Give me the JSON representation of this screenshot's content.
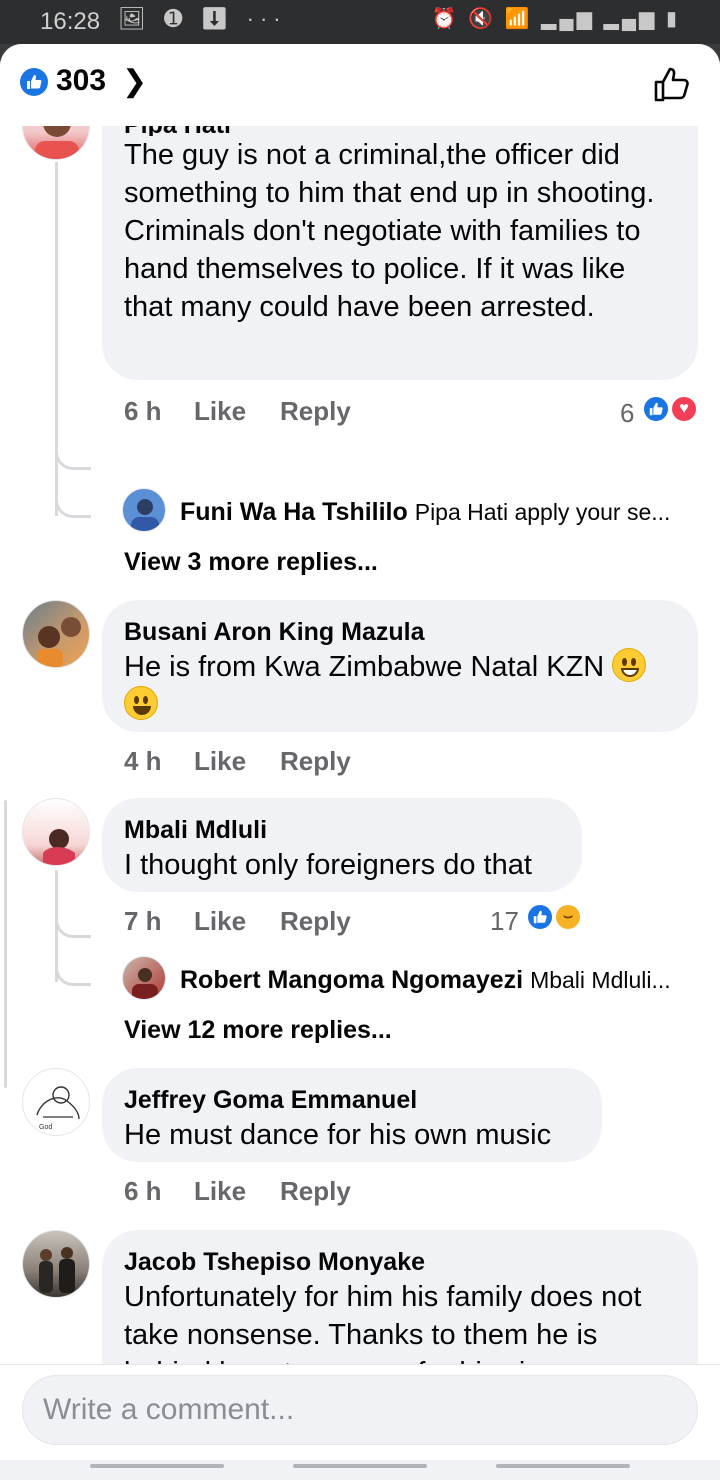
{
  "status_bar": {
    "time": "16:28",
    "left_icons": "🖼 ➊ ⬇ ···",
    "right_icons": "⏰ 🔇 📶 ▂▄▆ ▂▄▆ ▮"
  },
  "header": {
    "reaction_count": "303"
  },
  "comments": [
    {
      "author": "Pipa Hati",
      "text": "The guy is not a criminal,the officer did something to him that end up in shooting. Criminals don't negotiate with families to hand themselves to police. If it was like that many could have been arrested.",
      "time": "6 h",
      "like_label": "Like",
      "reply_label": "Reply",
      "reactions": "6",
      "reply_preview": {
        "author": "Funi Wa Ha Tshililo",
        "text": "Pipa Hati apply your se..."
      },
      "view_more": "View 3 more replies..."
    },
    {
      "author": "Busani Aron King Mazula",
      "text": "He is from Kwa Zimbabwe Natal KZN",
      "time": "4 h",
      "like_label": "Like",
      "reply_label": "Reply"
    },
    {
      "author": "Mbali Mdluli",
      "text": "I thought only foreigners do that",
      "time": "7 h",
      "like_label": "Like",
      "reply_label": "Reply",
      "reactions": "17",
      "reply_preview": {
        "author": "Robert Mangoma Ngomayezi",
        "text": "Mbali Mdluli..."
      },
      "view_more": "View 12 more replies..."
    },
    {
      "author": "Jeffrey Goma Emmanuel",
      "text": "He must dance for his own music",
      "time": "6 h",
      "like_label": "Like",
      "reply_label": "Reply",
      "avatar_text": "God"
    },
    {
      "author": "Jacob Tshepiso Monyake",
      "text": "Unfortunately for him his family does not take nonsense. Thanks to them he is behind bars to answer for his sins"
    }
  ],
  "composer": {
    "placeholder": "Write a comment..."
  }
}
